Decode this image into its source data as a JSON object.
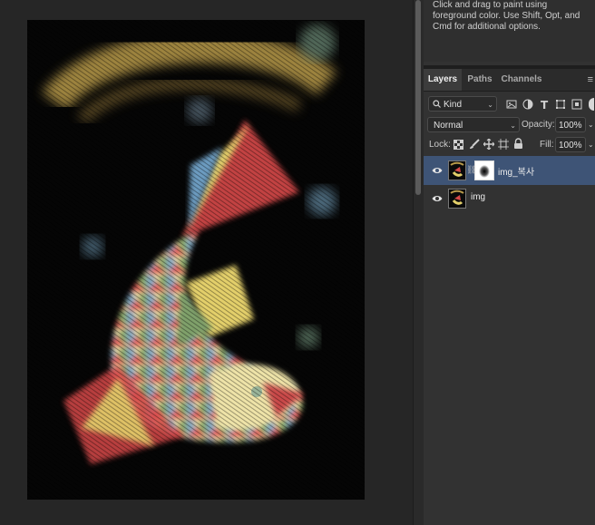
{
  "info": {
    "text": "Click and drag to paint using foreground color.  Use Shift, Opt, and Cmd for additional options."
  },
  "layers_panel": {
    "tabs": [
      {
        "label": "Layers",
        "active": true
      },
      {
        "label": "Paths",
        "active": false
      },
      {
        "label": "Channels",
        "active": false
      }
    ],
    "filter_kind": "Kind",
    "blend_mode": "Normal",
    "opacity_label": "Opacity:",
    "opacity_value": "100%",
    "lock_label": "Lock:",
    "fill_label": "Fill:",
    "fill_value": "100%",
    "layers": [
      {
        "name": "img_복사",
        "visible": true,
        "selected": true,
        "has_mask": true
      },
      {
        "name": "img",
        "visible": true,
        "selected": false,
        "has_mask": false
      }
    ]
  },
  "colors": {
    "selection": "#3e5476",
    "panel_bg": "#323232",
    "canvas_bg": "#262626"
  },
  "icons": [
    "eye-icon",
    "search-icon",
    "lock-icon",
    "brush-icon",
    "move-icon",
    "link-icon",
    "panel-menu-icon"
  ]
}
